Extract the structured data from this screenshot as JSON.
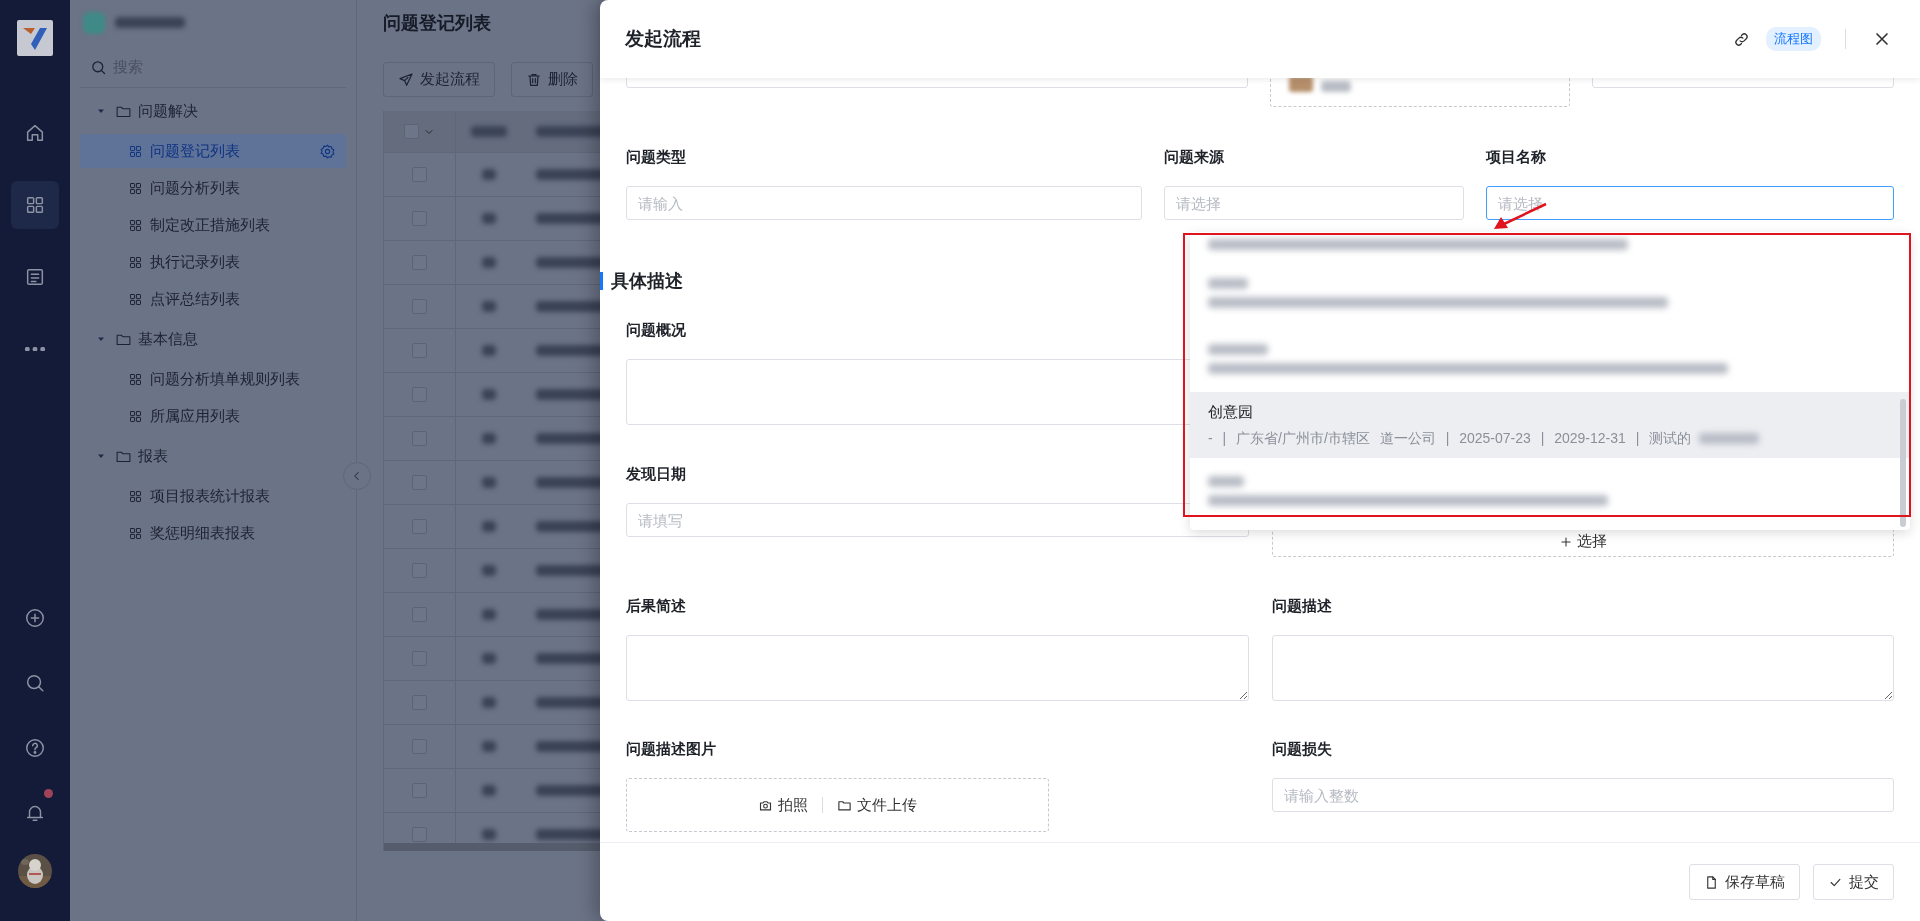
{
  "rail": {
    "top": [
      {
        "kind": "home",
        "selected": false
      },
      {
        "kind": "apps",
        "selected": true
      },
      {
        "kind": "doc",
        "selected": false
      },
      {
        "kind": "more",
        "selected": false
      }
    ],
    "bottom": [
      {
        "kind": "add"
      },
      {
        "kind": "search"
      },
      {
        "kind": "help"
      },
      {
        "kind": "bell",
        "badge": true
      },
      {
        "kind": "avatar"
      }
    ]
  },
  "sidebar": {
    "search": {
      "placeholder": "搜索"
    },
    "tree": [
      {
        "label": "问题解决",
        "expanded": true,
        "children": [
          {
            "label": "问题登记列表",
            "selected": true
          },
          {
            "label": "问题分析列表",
            "selected": false
          },
          {
            "label": "制定改正措施列表",
            "selected": false
          },
          {
            "label": "执行记录列表",
            "selected": false
          },
          {
            "label": "点评总结列表",
            "selected": false
          }
        ]
      },
      {
        "label": "基本信息",
        "expanded": true,
        "children": [
          {
            "label": "问题分析填单规则列表",
            "selected": false
          },
          {
            "label": "所属应用列表",
            "selected": false
          }
        ]
      },
      {
        "label": "报表",
        "expanded": true,
        "children": [
          {
            "label": "项目报表统计报表",
            "selected": false
          },
          {
            "label": "奖惩明细表报表",
            "selected": false
          }
        ]
      }
    ]
  },
  "list_page": {
    "title": "问题登记列表",
    "toolbar": [
      {
        "kind": "send",
        "label": "发起流程"
      },
      {
        "kind": "delete",
        "label": "删除"
      }
    ],
    "table": {
      "header_checked": false,
      "rows": [
        {
          "checked": false
        },
        {
          "checked": false
        },
        {
          "checked": false
        },
        {
          "checked": false
        },
        {
          "checked": false
        },
        {
          "checked": false
        },
        {
          "checked": false
        },
        {
          "checked": false
        },
        {
          "checked": false
        },
        {
          "checked": false
        },
        {
          "checked": false
        },
        {
          "checked": false
        },
        {
          "checked": false
        },
        {
          "checked": false
        },
        {
          "checked": false
        },
        {
          "checked": false
        }
      ]
    }
  },
  "dialog": {
    "title": "发起流程",
    "header_actions": [
      {
        "kind": "link"
      },
      {
        "kind": "tag",
        "label": "流程图"
      },
      {
        "kind": "close"
      }
    ],
    "partial_row": [
      {
        "kind": "input"
      },
      {
        "kind": "upload"
      },
      {
        "kind": "input"
      }
    ],
    "fields_top": [
      {
        "label": "问题类型",
        "kind": "input",
        "placeholder": "请输入",
        "focused": false
      },
      {
        "label": "问题来源",
        "kind": "input",
        "placeholder": "请选择",
        "focused": false
      },
      {
        "label": "项目名称",
        "kind": "input",
        "placeholder": "请选择",
        "focused": true
      }
    ],
    "section": {
      "title": "具体描述"
    },
    "rows": [
      [
        {
          "label": "问题概况",
          "kind": "textarea"
        }
      ],
      [
        {
          "label": "发现日期",
          "kind": "input",
          "placeholder": "请填写"
        },
        {
          "kind": "picker",
          "button": "选择"
        }
      ],
      [
        {
          "label": "后果简述",
          "kind": "textarea"
        },
        {
          "label": "问题描述",
          "kind": "textarea"
        }
      ],
      [
        {
          "label": "问题描述图片",
          "kind": "upload",
          "actions": [
            {
              "kind": "camera",
              "label": "拍照"
            },
            {
              "kind": "folder",
              "label": "文件上传"
            }
          ]
        },
        {
          "label": "问题损失",
          "kind": "input",
          "placeholder": "请输入整数"
        }
      ]
    ],
    "dropdown": {
      "options": [
        {
          "blurred": true,
          "highlighted": false
        },
        {
          "blurred": true,
          "highlighted": false
        },
        {
          "blurred": true,
          "highlighted": false
        },
        {
          "title": "创意园",
          "detail": "- | 广东省/广州市/市辖区 道一公司 | 2025-07-23 | 2029-12-31 | 测试的",
          "blurred": false,
          "highlighted": true
        },
        {
          "blurred": true,
          "highlighted": false
        }
      ]
    },
    "annotations": {
      "highlight_box": true,
      "arrow": true
    },
    "footer": [
      {
        "kind": "draft",
        "label": "保存草稿"
      },
      {
        "kind": "submit",
        "label": "提交"
      }
    ]
  }
}
